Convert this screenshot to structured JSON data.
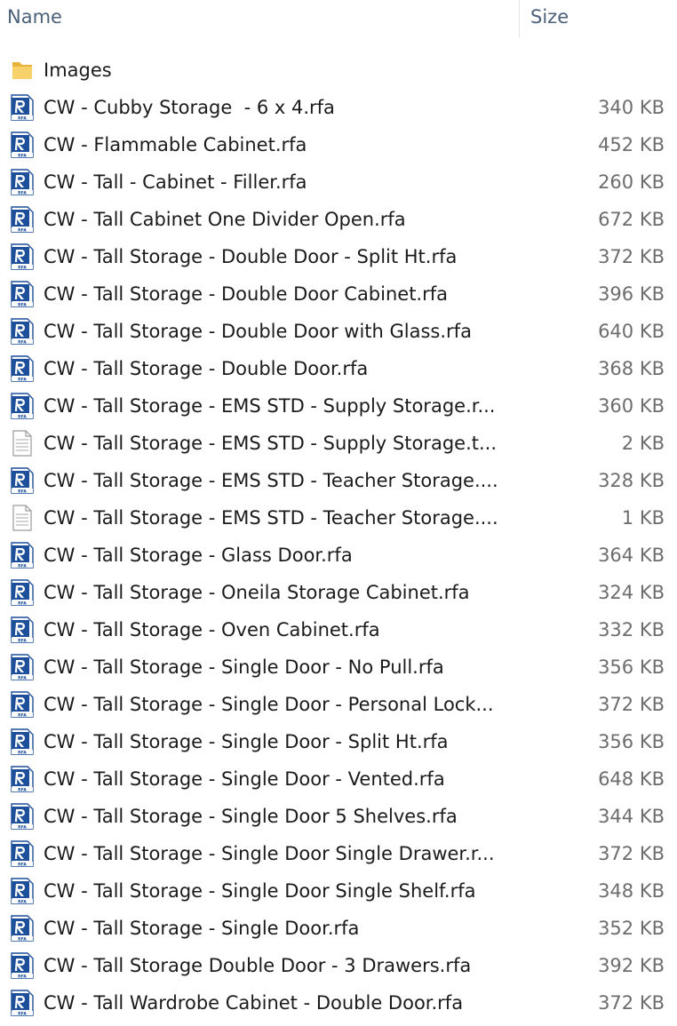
{
  "columns": {
    "name": "Name",
    "size": "Size"
  },
  "colors": {
    "header_text": "#4c607a",
    "name_text": "#1b1b1b",
    "size_text": "#6d6d6d",
    "rfa_blue": "#1d4f9a",
    "folder_yellow": "#f4c54a"
  },
  "files": [
    {
      "icon": "folder-icon",
      "name": "Images",
      "size": ""
    },
    {
      "icon": "rfa-file-icon",
      "name": "CW - Cubby Storage  - 6 x 4.rfa",
      "size": "340 KB"
    },
    {
      "icon": "rfa-file-icon",
      "name": "CW - Flammable Cabinet.rfa",
      "size": "452 KB"
    },
    {
      "icon": "rfa-file-icon",
      "name": "CW - Tall - Cabinet - Filler.rfa",
      "size": "260 KB"
    },
    {
      "icon": "rfa-file-icon",
      "name": "CW - Tall Cabinet One Divider Open.rfa",
      "size": "672 KB"
    },
    {
      "icon": "rfa-file-icon",
      "name": "CW - Tall Storage - Double Door - Split Ht.rfa",
      "size": "372 KB"
    },
    {
      "icon": "rfa-file-icon",
      "name": "CW - Tall Storage - Double Door Cabinet.rfa",
      "size": "396 KB"
    },
    {
      "icon": "rfa-file-icon",
      "name": "CW - Tall Storage - Double Door with Glass.rfa",
      "size": "640 KB"
    },
    {
      "icon": "rfa-file-icon",
      "name": "CW - Tall Storage - Double Door.rfa",
      "size": "368 KB"
    },
    {
      "icon": "rfa-file-icon",
      "name": "CW - Tall Storage - EMS STD - Supply Storage.r...",
      "size": "360 KB"
    },
    {
      "icon": "text-file-icon",
      "name": "CW - Tall Storage - EMS STD - Supply Storage.t...",
      "size": "2 KB"
    },
    {
      "icon": "rfa-file-icon",
      "name": "CW - Tall Storage - EMS STD - Teacher Storage....",
      "size": "328 KB"
    },
    {
      "icon": "text-file-icon",
      "name": "CW - Tall Storage - EMS STD - Teacher Storage....",
      "size": "1 KB"
    },
    {
      "icon": "rfa-file-icon",
      "name": "CW - Tall Storage - Glass Door.rfa",
      "size": "364 KB"
    },
    {
      "icon": "rfa-file-icon",
      "name": "CW - Tall Storage - Oneila Storage Cabinet.rfa",
      "size": "324 KB"
    },
    {
      "icon": "rfa-file-icon",
      "name": "CW - Tall Storage - Oven Cabinet.rfa",
      "size": "332 KB"
    },
    {
      "icon": "rfa-file-icon",
      "name": "CW - Tall Storage - Single Door - No Pull.rfa",
      "size": "356 KB"
    },
    {
      "icon": "rfa-file-icon",
      "name": "CW - Tall Storage - Single Door - Personal Lock...",
      "size": "372 KB"
    },
    {
      "icon": "rfa-file-icon",
      "name": "CW - Tall Storage - Single Door - Split Ht.rfa",
      "size": "356 KB"
    },
    {
      "icon": "rfa-file-icon",
      "name": "CW - Tall Storage - Single Door - Vented.rfa",
      "size": "648 KB"
    },
    {
      "icon": "rfa-file-icon",
      "name": "CW - Tall Storage - Single Door 5 Shelves.rfa",
      "size": "344 KB"
    },
    {
      "icon": "rfa-file-icon",
      "name": "CW - Tall Storage - Single Door Single Drawer.r...",
      "size": "372 KB"
    },
    {
      "icon": "rfa-file-icon",
      "name": "CW - Tall Storage - Single Door Single Shelf.rfa",
      "size": "348 KB"
    },
    {
      "icon": "rfa-file-icon",
      "name": "CW - Tall Storage - Single Door.rfa",
      "size": "352 KB"
    },
    {
      "icon": "rfa-file-icon",
      "name": "CW - Tall Storage Double Door - 3 Drawers.rfa",
      "size": "392 KB"
    },
    {
      "icon": "rfa-file-icon",
      "name": "CW - Tall Wardrobe Cabinet - Double Door.rfa",
      "size": "372 KB"
    }
  ]
}
